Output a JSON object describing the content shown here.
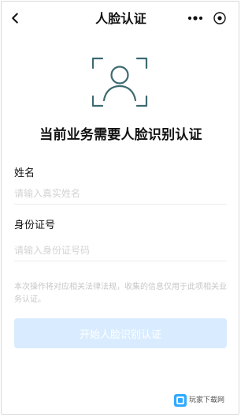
{
  "header": {
    "title": "人脸认证",
    "icons": {
      "back": "chevron-left-icon",
      "more": "more-dots-icon",
      "close": "close-circle-icon"
    }
  },
  "hero": {
    "icon": "face-scan-icon",
    "accent_color": "#3d6b71",
    "headline": "当前业务需要人脸识别认证"
  },
  "form": {
    "name_label": "姓名",
    "name_placeholder": "请输入真实姓名",
    "id_label": "身份证号",
    "id_placeholder": "请输入身份证号码"
  },
  "notice": {
    "text": "本次操作将对应相关法律法规，收集的信息仅用于此项相关业务认证。"
  },
  "actions": {
    "submit_label": "开始人脸识别认证",
    "submit_bg": "#d9ecff"
  },
  "watermark": {
    "text": "玩家下载网"
  }
}
